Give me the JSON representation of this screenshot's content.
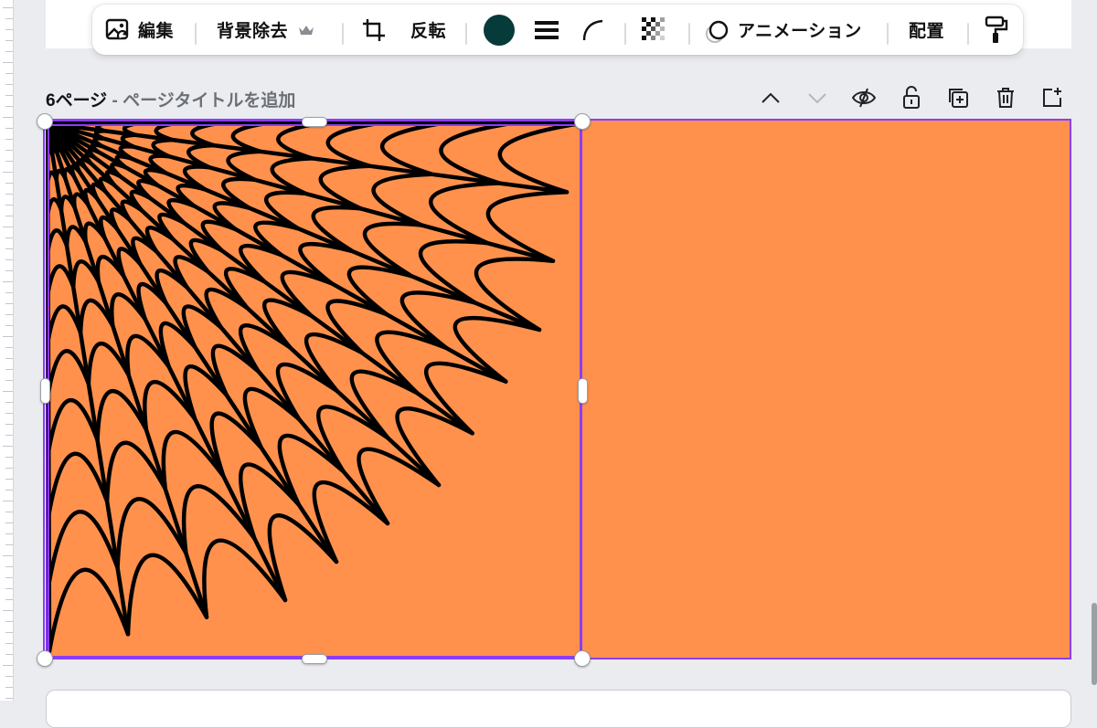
{
  "toolbar": {
    "edit_label": "編集",
    "bg_remove_label": "背景除去",
    "flip_label": "反転",
    "animation_label": "アニメーション",
    "position_label": "配置",
    "color_swatch": "#073b3a",
    "icons": [
      "edit-image-icon",
      "crown-icon",
      "crop-icon",
      "color-swatch",
      "border-style-icon",
      "corner-rounding-icon",
      "transparency-icon",
      "animation-icon",
      "copy-style-icon"
    ]
  },
  "page": {
    "number": "6ページ",
    "dash": " - ",
    "title_placeholder": "ページタイトルを追加"
  },
  "page_actions": [
    "chevron-up-icon",
    "chevron-down-icon",
    "hide-icon",
    "lock-icon",
    "duplicate-page-icon",
    "trash-icon",
    "add-page-icon"
  ],
  "colors": {
    "canvas_bg": "#ff914d",
    "selection": "#8b3dff",
    "web_stroke": "#000000"
  }
}
